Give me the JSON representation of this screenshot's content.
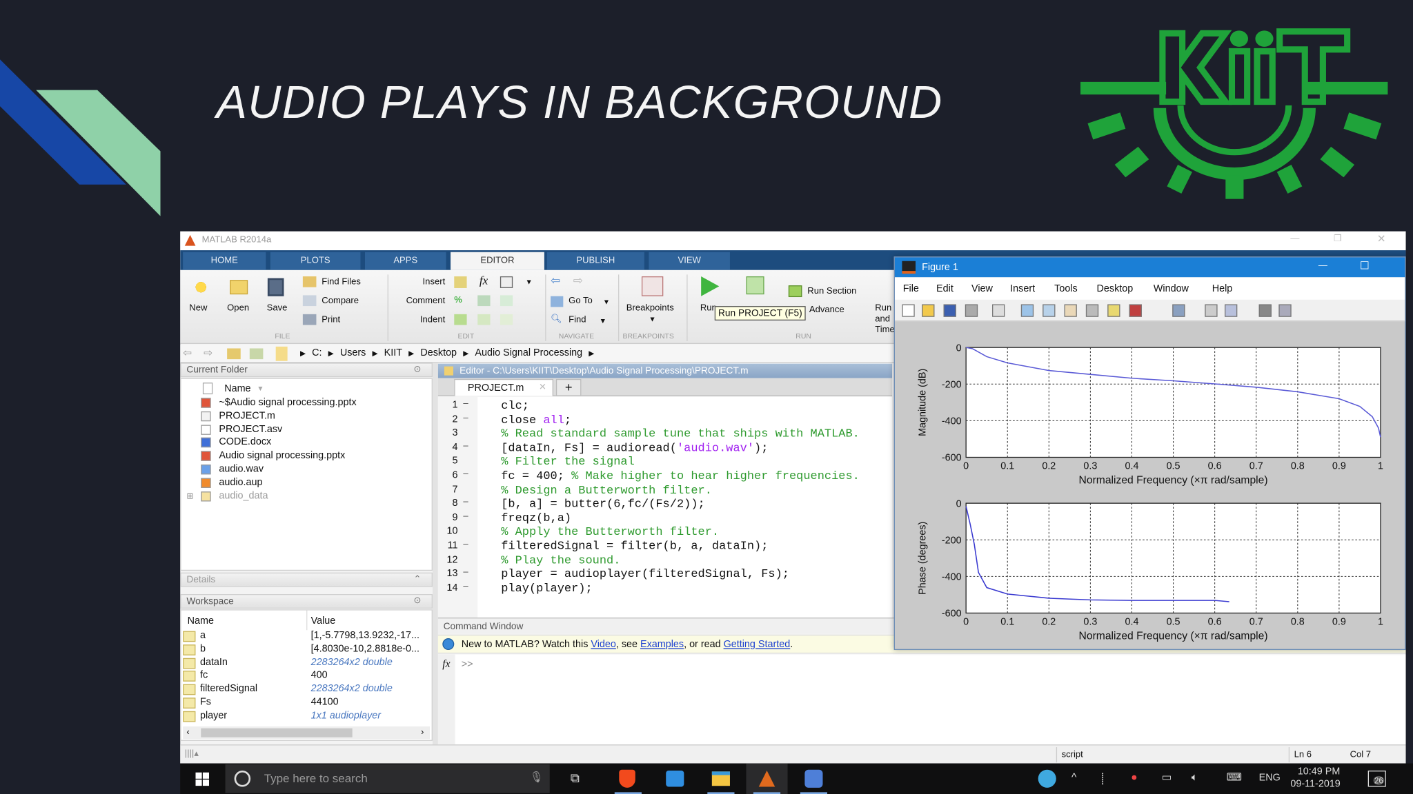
{
  "slide": {
    "title": "AUDIO PLAYS IN BACKGROUND",
    "logo_text": "KIIT",
    "colors": {
      "bg": "#1c1f2a",
      "blue": "#1747a6",
      "mint": "#8fd1a8",
      "logo": "#1fa33a"
    }
  },
  "matlab": {
    "title": "MATLAB R2014a",
    "tabs": [
      "HOME",
      "PLOTS",
      "APPS",
      "EDITOR",
      "PUBLISH",
      "VIEW"
    ],
    "active_tab": "EDITOR",
    "ribbon": {
      "file": {
        "new": "New",
        "open": "Open",
        "save": "Save",
        "find_files": "Find Files",
        "compare": "Compare",
        "print": "Print",
        "label": "FILE"
      },
      "edit": {
        "insert": "Insert",
        "comment": "Comment",
        "indent": "Indent",
        "fx": "fx",
        "label": "EDIT"
      },
      "navigate": {
        "go_to": "Go To",
        "find": "Find",
        "label": "NAVIGATE"
      },
      "breakpoints": {
        "breakpoints": "Breakpoints",
        "label": "BREAKPOINTS"
      },
      "run": {
        "run": "Run",
        "run_section": "Run Section",
        "advance": "Advance",
        "run_and_time": "Run and Time",
        "label": "RUN"
      },
      "tooltip": "Run PROJECT (F5)"
    },
    "address": [
      "C:",
      "Users",
      "KIIT",
      "Desktop",
      "Audio Signal Processing"
    ],
    "current_folder": {
      "header": "Current Folder",
      "column": "Name",
      "files": [
        {
          "name": "~$Audio signal processing.pptx",
          "icon": "pptx-icon"
        },
        {
          "name": "PROJECT.m",
          "icon": "m-file-icon"
        },
        {
          "name": "PROJECT.asv",
          "icon": "file-icon"
        },
        {
          "name": "CODE.docx",
          "icon": "docx-icon"
        },
        {
          "name": "Audio signal processing.pptx",
          "icon": "pptx-icon"
        },
        {
          "name": "audio.wav",
          "icon": "wav-icon"
        },
        {
          "name": "audio.aup",
          "icon": "audacity-icon"
        },
        {
          "name": "audio_data",
          "icon": "folder-icon"
        }
      ]
    },
    "details": {
      "header": "Details"
    },
    "workspace": {
      "header": "Workspace",
      "columns": [
        "Name",
        "Value"
      ],
      "variables": [
        {
          "name": "a",
          "value": "[1,-5.7798,13.9232,-17...",
          "italic": false
        },
        {
          "name": "b",
          "value": "[4.8030e-10,2.8818e-0...",
          "italic": false
        },
        {
          "name": "dataIn",
          "value": "2283264x2 double",
          "italic": true
        },
        {
          "name": "fc",
          "value": "400",
          "italic": false
        },
        {
          "name": "filteredSignal",
          "value": "2283264x2 double",
          "italic": true
        },
        {
          "name": "Fs",
          "value": "44100",
          "italic": false
        },
        {
          "name": "player",
          "value": "1x1 audioplayer",
          "italic": true
        }
      ]
    },
    "editor": {
      "title": "Editor - C:\\Users\\KIIT\\Desktop\\Audio Signal Processing\\PROJECT.m",
      "tab": "PROJECT.m",
      "new_tab": "+",
      "lines": [
        {
          "n": "1",
          "bp": true,
          "parts": [
            {
              "t": "clc;",
              "k": "code"
            }
          ]
        },
        {
          "n": "2",
          "bp": true,
          "parts": [
            {
              "t": "close ",
              "k": "code"
            },
            {
              "t": "all",
              "k": "string"
            },
            {
              "t": ";",
              "k": "code"
            }
          ]
        },
        {
          "n": "3",
          "bp": false,
          "parts": [
            {
              "t": "% Read standard sample tune that ships with MATLAB.",
              "k": "comment"
            }
          ]
        },
        {
          "n": "4",
          "bp": true,
          "parts": [
            {
              "t": "[dataIn, Fs] = audioread(",
              "k": "code"
            },
            {
              "t": "'audio.wav'",
              "k": "string"
            },
            {
              "t": ");",
              "k": "code"
            }
          ]
        },
        {
          "n": "5",
          "bp": false,
          "parts": [
            {
              "t": "% Filter the signal",
              "k": "comment"
            }
          ]
        },
        {
          "n": "6",
          "bp": true,
          "parts": [
            {
              "t": "fc = 400; ",
              "k": "code"
            },
            {
              "t": "% Make higher to hear higher frequencies.",
              "k": "comment"
            }
          ]
        },
        {
          "n": "7",
          "bp": false,
          "parts": [
            {
              "t": "% Design a Butterworth filter.",
              "k": "comment"
            }
          ]
        },
        {
          "n": "8",
          "bp": true,
          "parts": [
            {
              "t": "[b, a] = butter(6,fc/(Fs/2));",
              "k": "code"
            }
          ]
        },
        {
          "n": "9",
          "bp": true,
          "parts": [
            {
              "t": "freqz(b,a)",
              "k": "code"
            }
          ]
        },
        {
          "n": "10",
          "bp": false,
          "parts": [
            {
              "t": "% Apply the Butterworth filter.",
              "k": "comment"
            }
          ]
        },
        {
          "n": "11",
          "bp": true,
          "parts": [
            {
              "t": "filteredSignal = filter(b, a, dataIn);",
              "k": "code"
            }
          ]
        },
        {
          "n": "12",
          "bp": false,
          "parts": [
            {
              "t": "% Play the sound.",
              "k": "comment"
            }
          ]
        },
        {
          "n": "13",
          "bp": true,
          "parts": [
            {
              "t": "player = audioplayer(filteredSignal, Fs);",
              "k": "code"
            }
          ]
        },
        {
          "n": "14",
          "bp": true,
          "parts": [
            {
              "t": "play(player);",
              "k": "code"
            }
          ]
        }
      ]
    },
    "command_window": {
      "header": "Command Window",
      "banner": {
        "intro": "New to MATLAB? Watch this ",
        "video": "Video",
        "sep1": ", see ",
        "examples": "Examples",
        "sep2": ", or read ",
        "getting_started": "Getting Started",
        "end": "."
      },
      "fx": "fx",
      "prompt": ">>"
    },
    "status": {
      "type": "script",
      "ln": "Ln 6",
      "col": "Col 7"
    }
  },
  "figure": {
    "title": "Figure 1",
    "menu": [
      "File",
      "Edit",
      "View",
      "Insert",
      "Tools",
      "Desktop",
      "Window",
      "Help"
    ]
  },
  "chart_data": [
    {
      "type": "line",
      "title": "",
      "xlabel": "Normalized Frequency  (×π rad/sample)",
      "ylabel": "Magnitude (dB)",
      "xlim": [
        0,
        1
      ],
      "ylim": [
        -600,
        0
      ],
      "xticks": [
        "0",
        "0.1",
        "0.2",
        "0.3",
        "0.4",
        "0.5",
        "0.6",
        "0.7",
        "0.8",
        "0.9",
        "1"
      ],
      "yticks": [
        "0",
        "-200",
        "-400",
        "-600"
      ],
      "grid": true,
      "series": [
        {
          "name": "magnitude",
          "color": "#5a5ad6",
          "x": [
            0,
            0.016,
            0.05,
            0.1,
            0.2,
            0.3,
            0.4,
            0.5,
            0.6,
            0.7,
            0.8,
            0.9,
            0.95,
            0.98,
            0.995,
            1
          ],
          "y": [
            0,
            -7,
            -50,
            -84,
            -126,
            -147,
            -168,
            -182,
            -199,
            -217,
            -242,
            -280,
            -322,
            -378,
            -440,
            -490
          ]
        }
      ]
    },
    {
      "type": "line",
      "title": "",
      "xlabel": "Normalized Frequency  (×π rad/sample)",
      "ylabel": "Phase (degrees)",
      "xlim": [
        0,
        1
      ],
      "ylim": [
        -600,
        0
      ],
      "xticks": [
        "0",
        "0.1",
        "0.2",
        "0.3",
        "0.4",
        "0.5",
        "0.6",
        "0.7",
        "0.8",
        "0.9",
        "1"
      ],
      "yticks": [
        "0",
        "-200",
        "-400",
        "-600"
      ],
      "grid": true,
      "series": [
        {
          "name": "phase",
          "color": "#3a3ad0",
          "x": [
            0,
            0.01,
            0.02,
            0.03,
            0.05,
            0.1,
            0.2,
            0.3,
            0.4,
            0.5,
            0.6,
            0.635
          ],
          "y": [
            -17,
            -114,
            -225,
            -378,
            -461,
            -496,
            -519,
            -528,
            -531,
            -531,
            -531,
            -538
          ]
        }
      ]
    }
  ],
  "taskbar": {
    "search_placeholder": "Type here to search",
    "time": "10:49 PM",
    "date": "09-11-2019",
    "language": "ENG",
    "notifications": "26"
  }
}
